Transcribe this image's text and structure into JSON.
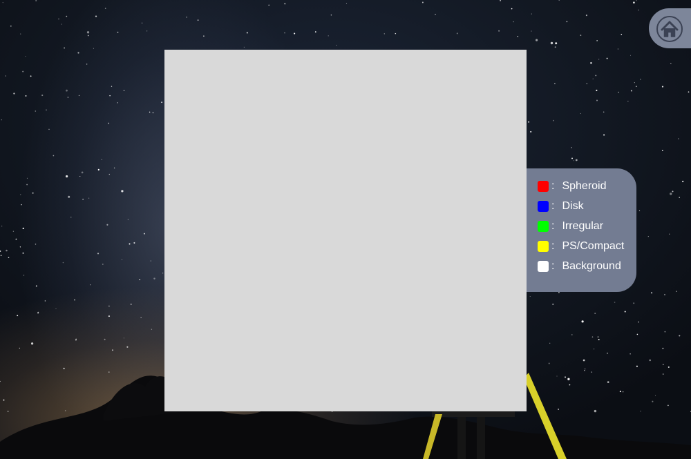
{
  "home": {
    "icon": "home-icon"
  },
  "viewer": {
    "content": ""
  },
  "legend": {
    "items": [
      {
        "label": "Spheroid",
        "color": "#ff0000"
      },
      {
        "label": "Disk",
        "color": "#0000ff"
      },
      {
        "label": "Irregular",
        "color": "#00ff00"
      },
      {
        "label": "PS/Compact",
        "color": "#ffff00"
      },
      {
        "label": "Background",
        "color": "#ffffff"
      }
    ],
    "separator": ":"
  }
}
